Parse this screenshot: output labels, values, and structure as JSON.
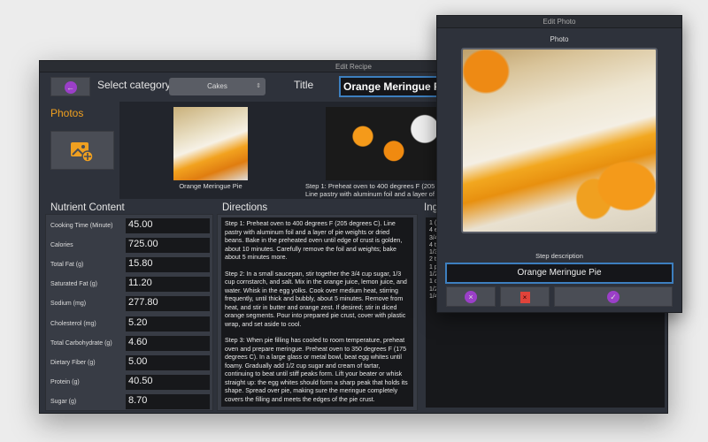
{
  "main_window": {
    "title": "Edit Recipe",
    "select_category_label": "Select category",
    "category_value": "Cakes",
    "title_label": "Title",
    "title_value": "Orange Meringue Pie",
    "photos_label": "Photos",
    "photo_strip": [
      {
        "caption": "Orange Meringue Pie"
      },
      {
        "caption_line1": "Step 1: Preheat oven to 400 degrees F (205",
        "caption_line2": "Line pastry with aluminum foil and a layer of"
      }
    ]
  },
  "nutrients": {
    "heading": "Nutrient Content",
    "rows": [
      {
        "label": "Cooking Time (Minute)",
        "value": "45.00"
      },
      {
        "label": "Calories",
        "value": "725.00"
      },
      {
        "label": "Total Fat (g)",
        "value": "15.80"
      },
      {
        "label": "Saturated Fat (g)",
        "value": "11.20"
      },
      {
        "label": "Sodium (mg)",
        "value": "277.80"
      },
      {
        "label": "Cholesterol (mg)",
        "value": "5.20"
      },
      {
        "label": "Total Carbohydrate (g)",
        "value": "4.60"
      },
      {
        "label": "Dietary Fiber (g)",
        "value": "5.00"
      },
      {
        "label": "Protein (g)",
        "value": "40.50"
      },
      {
        "label": "Sugar (g)",
        "value": "8.70"
      }
    ]
  },
  "directions": {
    "heading": "Directions",
    "steps": [
      "Step 1: Preheat oven to 400 degrees F (205 degrees C). Line pastry with aluminum foil and a layer of pie weights or dried beans. Bake in the preheated oven until edge of crust is golden, about 10 minutes. Carefully remove the foil and weights; bake about 5 minutes more.",
      "Step 2: In a small saucepan, stir together the 3/4 cup sugar, 1/3 cup cornstarch, and salt. Mix in the orange juice, lemon juice, and water. Whisk in the egg yolks. Cook over medium heat, stirring frequently, until thick and bubbly, about 5 minutes. Remove from heat, and stir in butter and orange zest. If desired; stir in diced orange segments. Pour into prepared pie crust, cover with plastic wrap, and set aside to cool.",
      "Step 3: When pie filling has cooled to room temperature, preheat oven and prepare meringue. Preheat oven to 350 degrees F (175 degrees C). In a large glass or metal bowl, beat egg whites until foamy. Gradually add 1/2 cup sugar and cream of tartar, continuing to beat until stiff peaks form. Lift your beater or whisk straight up: the egg whites should form a sharp peak that holds its shape. Spread over pie, making sure the meringue completely covers the filling and meets the edges of the pie crust."
    ]
  },
  "ingredients": {
    "heading": "Ing",
    "items": [
      "1 (9",
      "4 eg",
      "3/4",
      "4 ta",
      "1/3",
      "2 te",
      "1 pi",
      "1/2",
      "1 cu",
      "1/2",
      "1/4"
    ]
  },
  "edit_photo": {
    "title": "Edit Photo",
    "photo_label": "Photo",
    "step_description_label": "Step description",
    "step_description_value": "Orange Meringue Pie"
  },
  "colors": {
    "accent_purple": "#9b3fc8",
    "accent_orange": "#f0a020",
    "delete_red": "#e0433a",
    "focus_blue": "#3d7fbf"
  }
}
